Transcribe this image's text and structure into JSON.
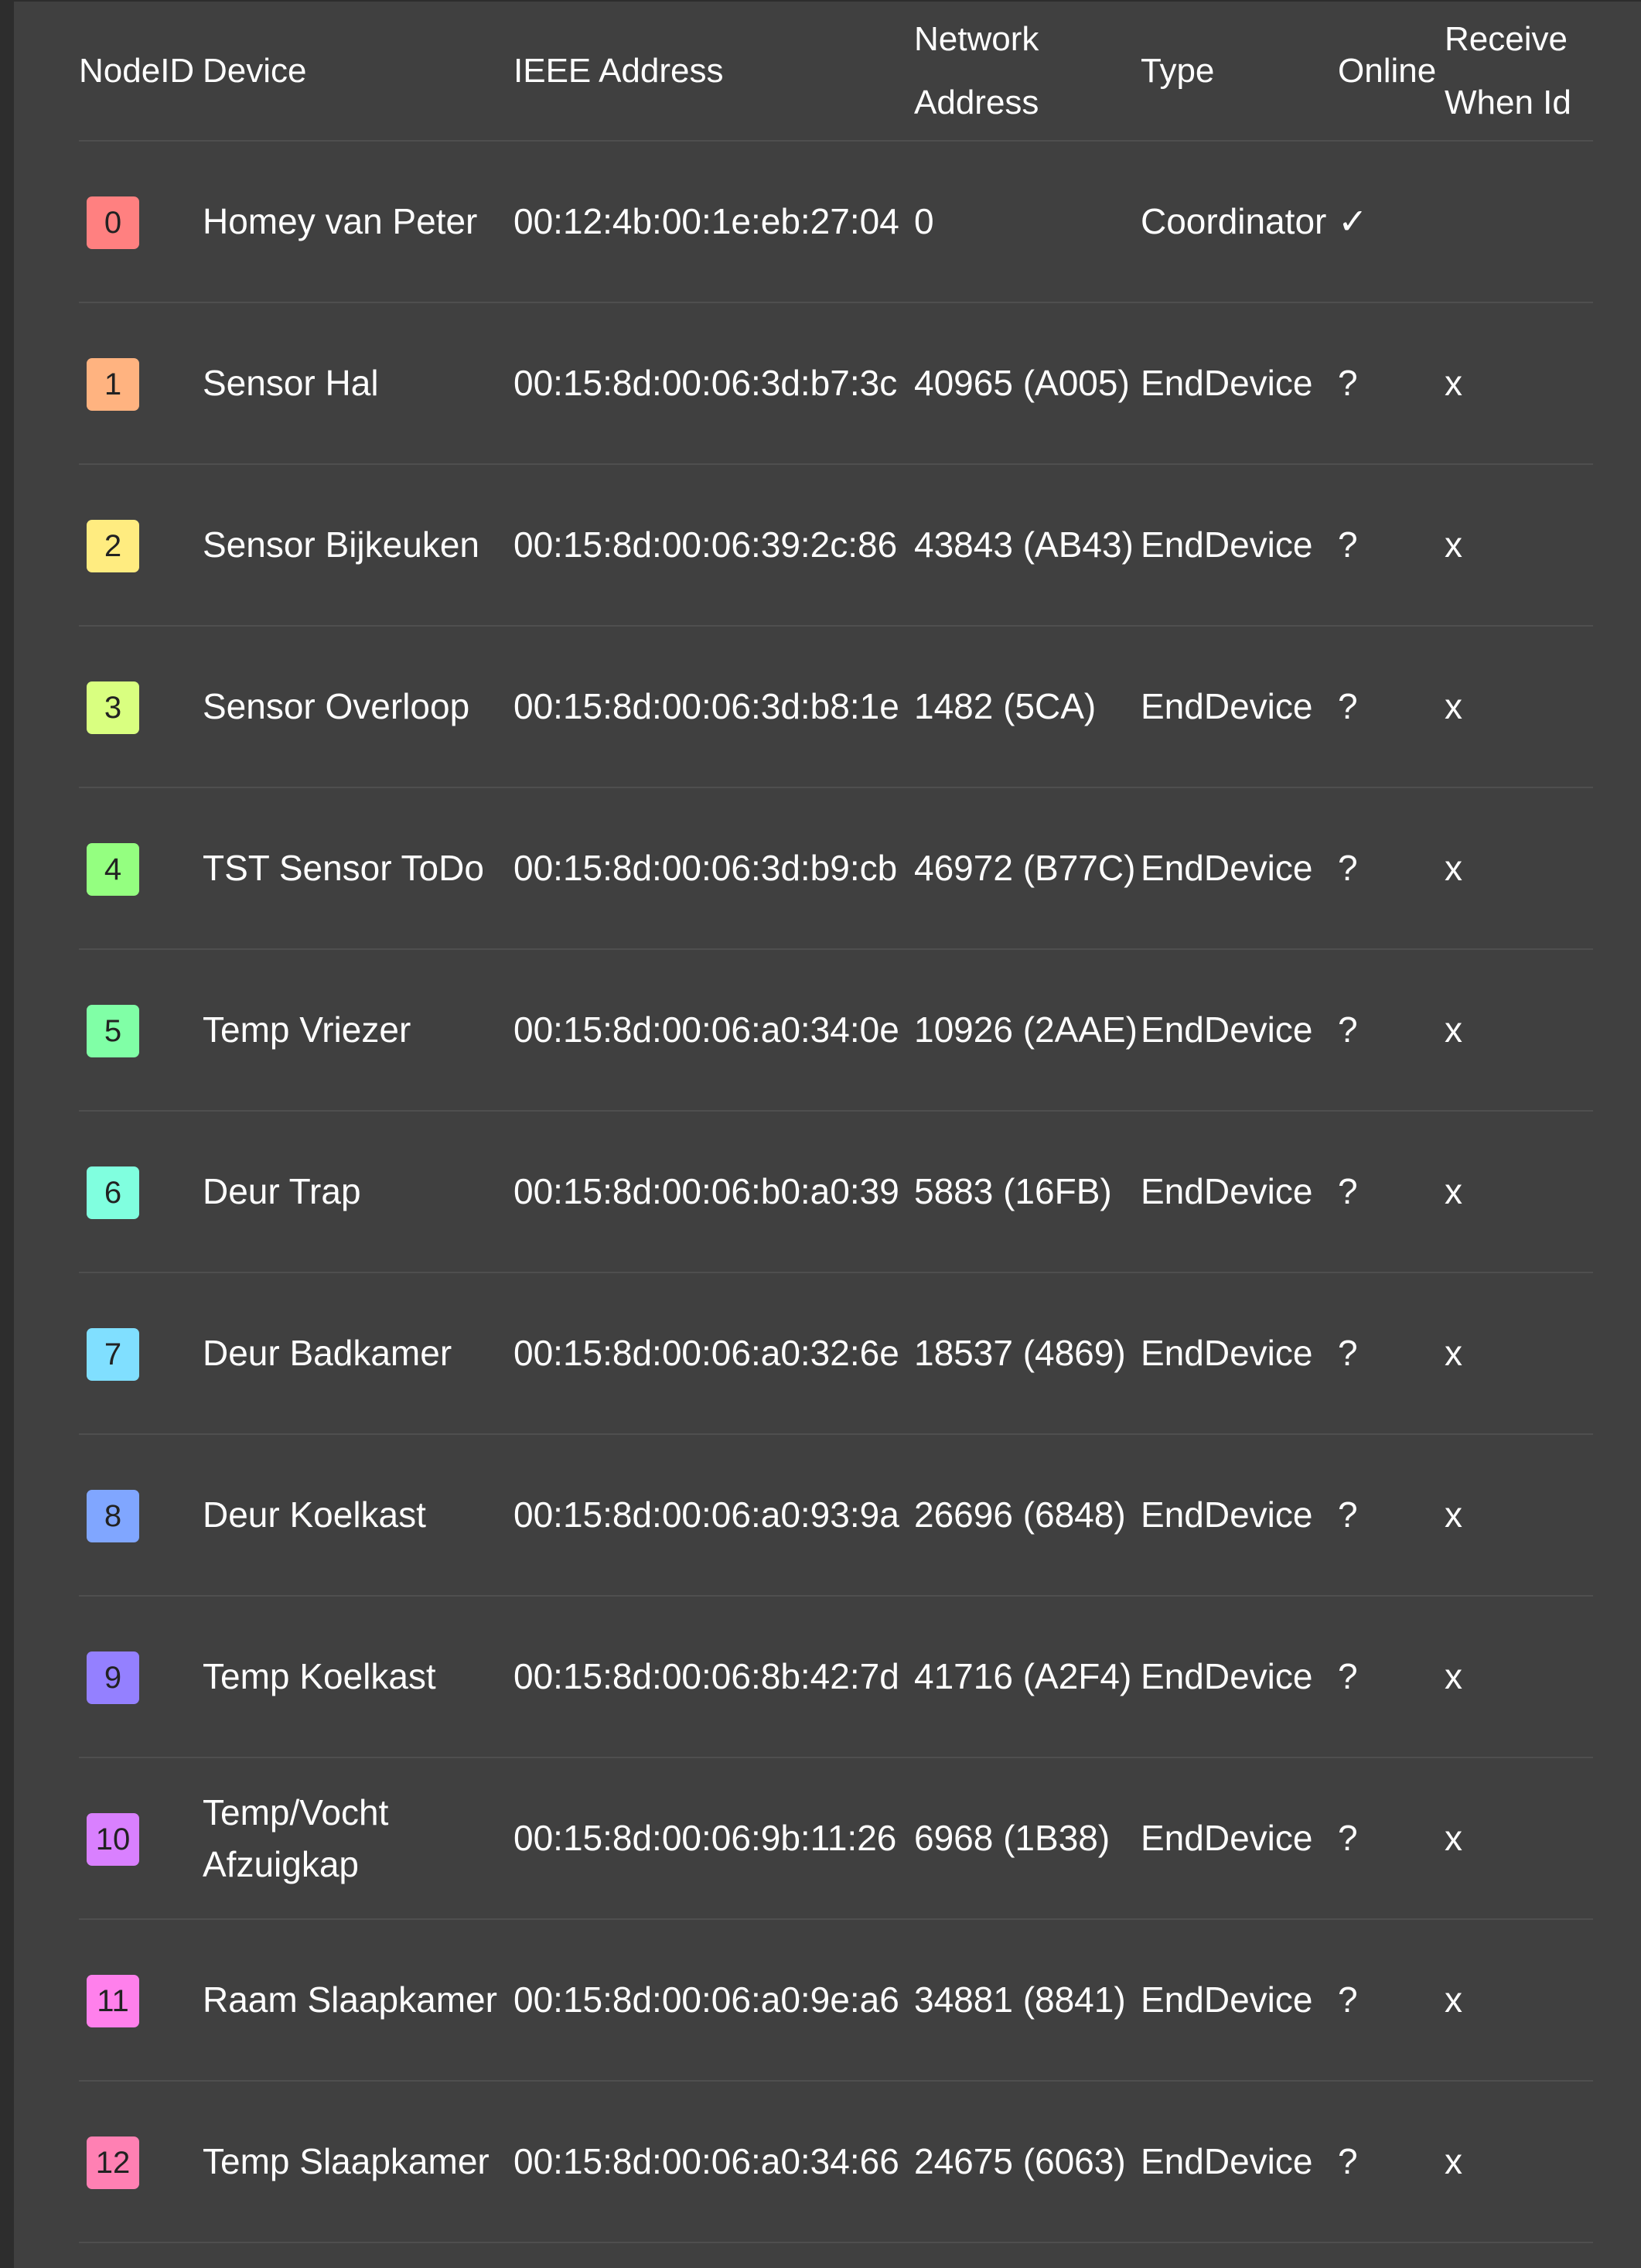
{
  "columns": {
    "nodeid": "NodeID",
    "device": "Device",
    "ieee": "IEEE Address",
    "network": "Network Address",
    "type": "Type",
    "online": "Online",
    "receive": "Receive When Id"
  },
  "rows": [
    {
      "id": "0",
      "color": "#ff8080",
      "device": "Homey van Peter",
      "ieee": "00:12:4b:00:1e:eb:27:04",
      "network": "0",
      "type": "Coordinator",
      "online": "✓",
      "receive": ""
    },
    {
      "id": "1",
      "color": "#ffb380",
      "device": "Sensor Hal",
      "ieee": "00:15:8d:00:06:3d:b7:3c",
      "network": "40965 (A005)",
      "type": "EndDevice",
      "online": "?",
      "receive": "x"
    },
    {
      "id": "2",
      "color": "#ffec80",
      "device": "Sensor Bijkeuken",
      "ieee": "00:15:8d:00:06:39:2c:86",
      "network": "43843 (AB43)",
      "type": "EndDevice",
      "online": "?",
      "receive": "x"
    },
    {
      "id": "3",
      "color": "#d9ff80",
      "device": "Sensor Overloop",
      "ieee": "00:15:8d:00:06:3d:b8:1e",
      "network": "1482 (5CA)",
      "type": "EndDevice",
      "online": "?",
      "receive": "x"
    },
    {
      "id": "4",
      "color": "#94ff80",
      "device": "TST Sensor ToDo",
      "ieee": "00:15:8d:00:06:3d:b9:cb",
      "network": "46972 (B77C)",
      "type": "EndDevice",
      "online": "?",
      "receive": "x"
    },
    {
      "id": "5",
      "color": "#80ffa6",
      "device": "Temp Vriezer",
      "ieee": "00:15:8d:00:06:a0:34:0e",
      "network": "10926 (2AAE)",
      "type": "EndDevice",
      "online": "?",
      "receive": "x"
    },
    {
      "id": "6",
      "color": "#80ffdf",
      "device": "Deur Trap",
      "ieee": "00:15:8d:00:06:b0:a0:39",
      "network": "5883 (16FB)",
      "type": "EndDevice",
      "online": "?",
      "receive": "x"
    },
    {
      "id": "7",
      "color": "#80dfff",
      "device": "Deur Badkamer",
      "ieee": "00:15:8d:00:06:a0:32:6e",
      "network": "18537 (4869)",
      "type": "EndDevice",
      "online": "?",
      "receive": "x"
    },
    {
      "id": "8",
      "color": "#80a6ff",
      "device": "Deur Koelkast",
      "ieee": "00:15:8d:00:06:a0:93:9a",
      "network": "26696 (6848)",
      "type": "EndDevice",
      "online": "?",
      "receive": "x"
    },
    {
      "id": "9",
      "color": "#9480ff",
      "device": "Temp Koelkast",
      "ieee": "00:15:8d:00:06:8b:42:7d",
      "network": "41716 (A2F4)",
      "type": "EndDevice",
      "online": "?",
      "receive": "x"
    },
    {
      "id": "10",
      "color": "#d980ff",
      "device": "Temp/Vocht Afzuigkap",
      "ieee": "00:15:8d:00:06:9b:11:26",
      "network": "6968 (1B38)",
      "type": "EndDevice",
      "online": "?",
      "receive": "x"
    },
    {
      "id": "11",
      "color": "#ff80ec",
      "device": "Raam Slaapkamer",
      "ieee": "00:15:8d:00:06:a0:9e:a6",
      "network": "34881 (8841)",
      "type": "EndDevice",
      "online": "?",
      "receive": "x"
    },
    {
      "id": "12",
      "color": "#ff80b3",
      "device": "Temp Slaapkamer",
      "ieee": "00:15:8d:00:06:a0:34:66",
      "network": "24675 (6063)",
      "type": "EndDevice",
      "online": "?",
      "receive": "x"
    }
  ]
}
